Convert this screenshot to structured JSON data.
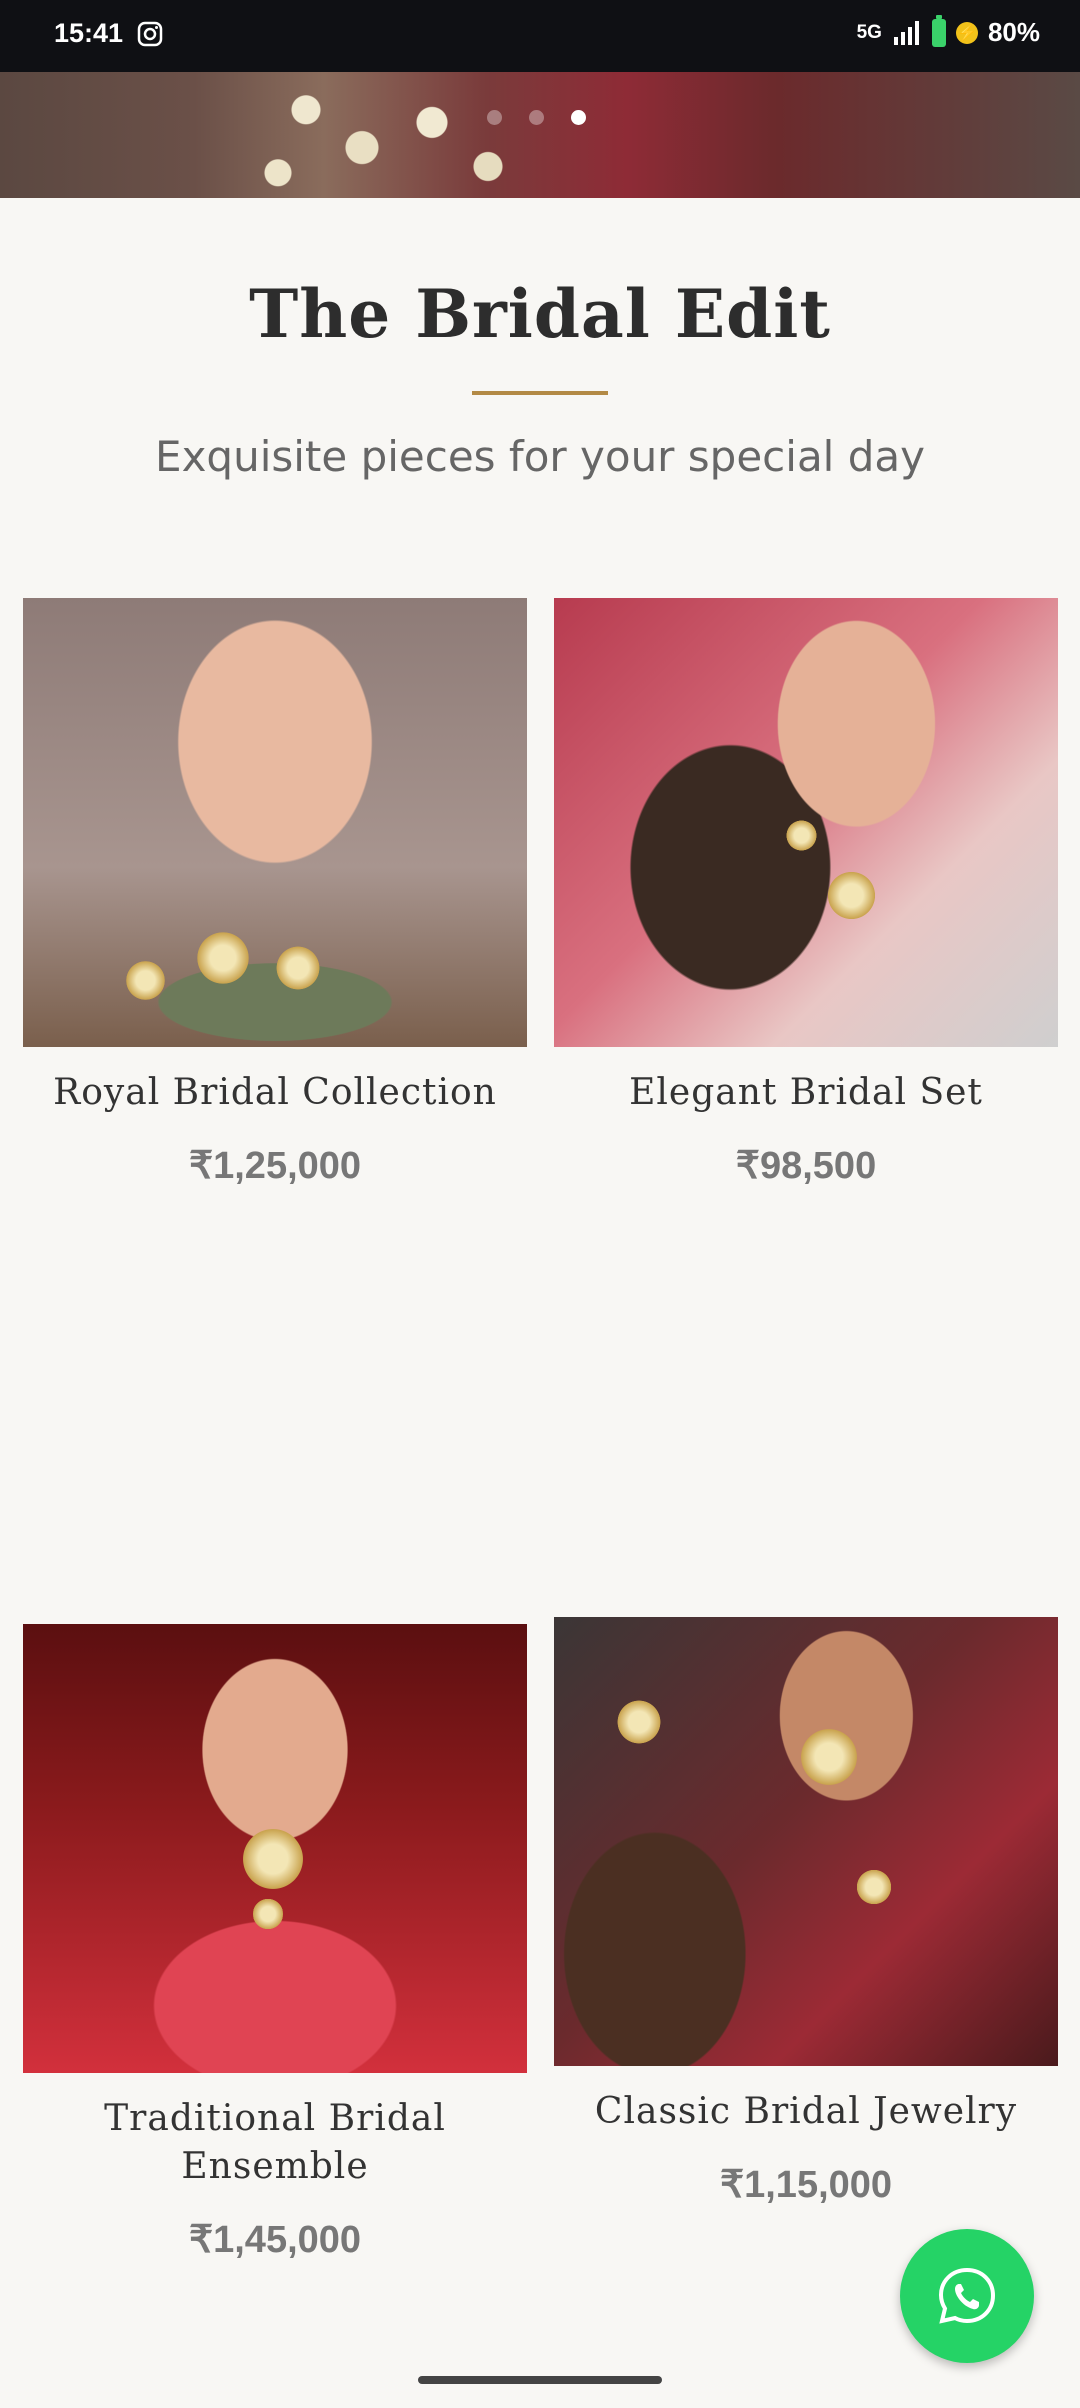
{
  "status_bar": {
    "time": "15:41",
    "network": "5G",
    "battery": "80%",
    "icons": [
      "instagram-icon",
      "signal-icon",
      "battery-icon",
      "charging-icon"
    ]
  },
  "hero": {
    "carousel_dots": 3,
    "active_dot": 3
  },
  "section": {
    "title": "The Bridal Edit",
    "subtitle": "Exquisite pieces for your special day",
    "accent_color": "#b38a45"
  },
  "products": [
    {
      "name": "Royal Bridal Collection",
      "price": "₹1,25,000"
    },
    {
      "name": "Elegant Bridal Set",
      "price": "₹98,500"
    },
    {
      "name": "Traditional Bridal Ensemble",
      "price": "₹1,45,000"
    },
    {
      "name": "Classic Bridal Jewelry",
      "price": "₹1,15,000"
    }
  ],
  "fab": {
    "icon": "whatsapp-icon",
    "color": "#25d366"
  }
}
